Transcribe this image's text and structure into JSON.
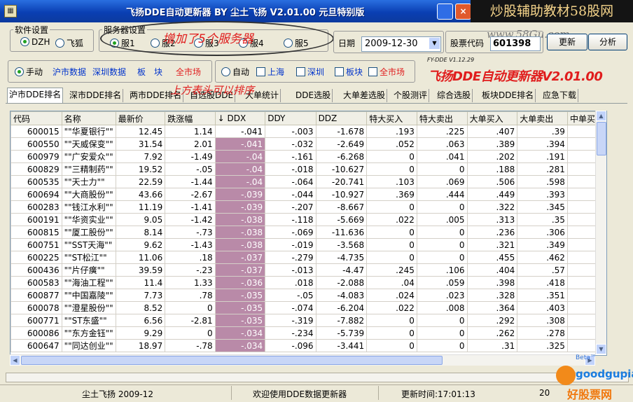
{
  "window": {
    "title": "飞扬DDE自动更新器 BY 尘土飞扬 V2.01.00 元旦特别版",
    "close_glyph": "×"
  },
  "watermark": {
    "top": "炒股辅助教材58股网",
    "url": "www.58Gu.com"
  },
  "software_settings": {
    "legend": "软件设置",
    "options": [
      "DZH",
      "飞狐"
    ],
    "selected": "DZH"
  },
  "server_settings": {
    "legend": "服务器设置",
    "options": [
      "服1",
      "服2",
      "服3",
      "服4",
      "服5"
    ],
    "selected": "服1"
  },
  "annotations": {
    "servers": "增加了5个服务器",
    "tabs": "上方表头可以排序"
  },
  "date": {
    "label": "日期",
    "value": "2009-12-30"
  },
  "stock_code": {
    "label": "股票代码",
    "value": "601398"
  },
  "buttons": {
    "update": "更新",
    "analyze": "分析"
  },
  "mode_group": {
    "options": [
      "手动"
    ],
    "selected": "手动",
    "links": [
      "沪市数据",
      "深圳数据",
      "板",
      "块",
      "全市场"
    ]
  },
  "auto_group": {
    "option": "自动",
    "checks": [
      "上海",
      "深圳",
      "板块",
      "全市场"
    ]
  },
  "brand": {
    "small": "FY-DDE V1.12.29",
    "large": "飞扬DDE自动更新器V2.01.00"
  },
  "tabs": [
    "沪市DDE排名",
    "深市DDE排名",
    "两市DDE排名",
    "自选股DDE",
    "大单统计",
    "DDE选股",
    "大单差选股",
    "个股测评",
    "综合选股",
    "板块DDE排名",
    "应急下载"
  ],
  "table": {
    "columns": [
      "代码",
      "名称",
      "最新价",
      "跌涨幅",
      "↓ DDX",
      "DDY",
      "DDZ",
      "特大买入",
      "特大卖出",
      "大单买入",
      "大单卖出",
      "中单买入"
    ],
    "rows": [
      [
        "600015",
        "\"\"华夏银行\"\"",
        "12.45",
        "1.14",
        "-.041",
        "-.003",
        "-1.678",
        ".193",
        ".225",
        ".407",
        ".39"
      ],
      [
        "600550",
        "\"\"天威保变\"\"",
        "31.54",
        "2.01",
        "-.041",
        "-.032",
        "-2.649",
        ".052",
        ".063",
        ".389",
        ".394"
      ],
      [
        "600979",
        "\"\"广安爱众\"\"",
        "7.92",
        "-1.49",
        "-.04",
        "-.161",
        "-6.268",
        "0",
        ".041",
        ".202",
        ".191"
      ],
      [
        "600829",
        "\"\"三精制药\"\"",
        "19.52",
        "-.05",
        "-.04",
        "-.018",
        "-10.627",
        "0",
        "0",
        ".188",
        ".281"
      ],
      [
        "600535",
        "\"\"天士力\"\"",
        "22.59",
        "-1.44",
        "-.04",
        "-.064",
        "-20.741",
        ".103",
        ".069",
        ".506",
        ".598"
      ],
      [
        "600694",
        "\"\"大商股份\"\"",
        "43.66",
        "-2.67",
        "-.039",
        "-.044",
        "-10.927",
        ".369",
        ".444",
        ".449",
        ".393"
      ],
      [
        "600283",
        "\"\"钱江水利\"\"",
        "11.19",
        "-1.41",
        "-.039",
        "-.207",
        "-8.667",
        "0",
        "0",
        ".322",
        ".345"
      ],
      [
        "600191",
        "\"\"华资实业\"\"",
        "9.05",
        "-1.42",
        "-.038",
        "-.118",
        "-5.669",
        ".022",
        ".005",
        ".313",
        ".35"
      ],
      [
        "600815",
        "\"\"厦工股份\"\"",
        "8.14",
        "-.73",
        "-.038",
        "-.069",
        "-11.636",
        "0",
        "0",
        ".236",
        ".306"
      ],
      [
        "600751",
        "\"\"SST天海\"\"",
        "9.62",
        "-1.43",
        "-.038",
        "-.019",
        "-3.568",
        "0",
        "0",
        ".321",
        ".349"
      ],
      [
        "600225",
        "\"\"ST松江\"\"",
        "11.06",
        ".18",
        "-.037",
        "-.279",
        "-4.735",
        "0",
        "0",
        ".455",
        ".462"
      ],
      [
        "600436",
        "\"\"片仔癀\"\"",
        "39.59",
        "-.23",
        "-.037",
        "-.013",
        "-4.47",
        ".245",
        ".106",
        ".404",
        ".57"
      ],
      [
        "600583",
        "\"\"海油工程\"\"",
        "11.4",
        "1.33",
        "-.036",
        ".018",
        "-2.088",
        ".04",
        ".059",
        ".398",
        ".418"
      ],
      [
        "600877",
        "\"\"中国嘉陵\"\"",
        "7.73",
        ".78",
        "-.035",
        "-.05",
        "-4.083",
        ".024",
        ".023",
        ".328",
        ".351"
      ],
      [
        "600078",
        "\"\"澄星股份\"\"",
        "8.52",
        "0",
        "-.035",
        "-.074",
        "-6.204",
        ".022",
        ".008",
        ".364",
        ".403"
      ],
      [
        "600771",
        "\"\"ST东盛\"\"",
        "6.56",
        "-2.81",
        "-.035",
        "-.319",
        "-7.882",
        "0",
        "0",
        ".292",
        ".308"
      ],
      [
        "600086",
        "\"\"东方金钰\"\"",
        "9.29",
        "0",
        "-.034",
        "-.234",
        "-5.739",
        "0",
        "0",
        ".262",
        ".278"
      ],
      [
        "600647",
        "\"\"同达创业\"\"",
        "18.97",
        "-.78",
        "-.034",
        "-.096",
        "-3.441",
        "0",
        "0",
        ".31",
        ".325"
      ]
    ]
  },
  "status": {
    "author": "尘土飞扬 2009-12",
    "welcome": "欢迎使用DDE数据更新器",
    "update_time": "更新时间:17:01:13",
    "tail": "20"
  },
  "badge": {
    "logo": "goodgupiao",
    "cn": "好股票网",
    "beta": "Beta™"
  }
}
